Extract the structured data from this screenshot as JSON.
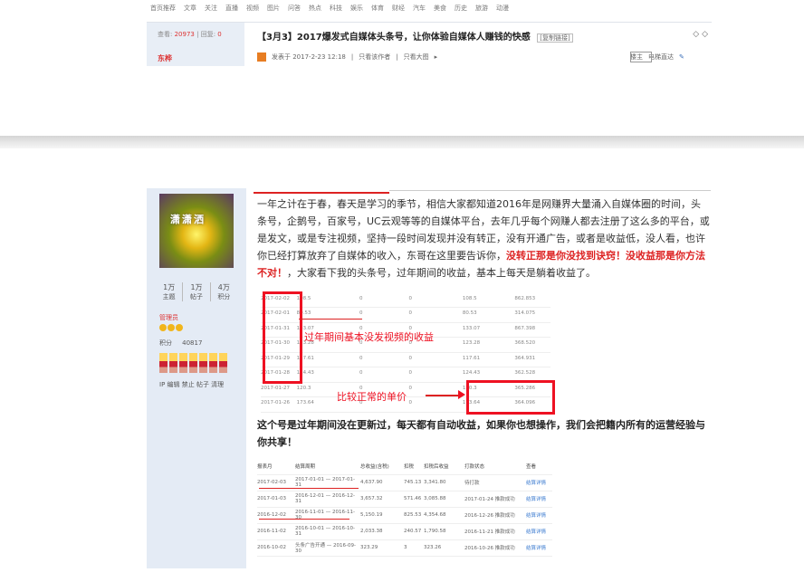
{
  "nav": [
    "首页推荐",
    "文章",
    "关注",
    "直播",
    "视频",
    "图片",
    "问答",
    "热点",
    "科技",
    "娱乐",
    "体育",
    "财经",
    "汽车",
    "美食",
    "历史",
    "旅游",
    "动漫"
  ],
  "post": {
    "views_label": "查看:",
    "views": "20973",
    "replies_label": "回复:",
    "replies": "0",
    "author": "东桦",
    "title": "【3月3】2017爆发式自媒体头条号，让你体验自媒体人赚钱的快感",
    "tag": "[复制链接]",
    "posted": "发表于 2017-2-23 12:18",
    "only_author": "只看该作者",
    "only_large": "只看大图",
    "floor_label": "楼主",
    "goto_label": "电梯直达"
  },
  "user": {
    "avatar_text": "潇潇洒",
    "topics": "1万",
    "topics_label": "主题",
    "posts": "1万",
    "posts_label": "帖子",
    "score": "4万",
    "score_label": "积分",
    "group": "管理员",
    "points_label": "积分",
    "points": "40817",
    "links": "IP 编辑 禁止 帖子 清理"
  },
  "body": {
    "paragraph": "一年之计在于春，春天是学习的季节，相信大家都知道2016年是网赚界大量涌入自媒体圈的时间，头条号，企鹅号，百家号，UC云观等等的自媒体平台，去年几乎每个网赚人都去注册了这么多的平台，或是发文，或是专注视频，坚持一段时间发现并没有转正，没有开通广告，或者是收益低，没人看，也许你已经打算放弃了自媒体的收入，东哥在这里要告诉你，",
    "red_text": "没转正那是你没找到诀窍！没收益那是你方法不对！",
    "tail": "，大家看下我的头条号，过年期间的收益，基本上每天是躺着收益了。",
    "annotation_1": "过年期间基本没发视频的收益",
    "annotation_2": "比较正常的单价",
    "summary": "这个号是过年期间没在更新过，每天都有自动收益，如果你也想操作，我们会把籍内所有的运营经验与你共享！"
  },
  "table1": [
    [
      "2017-02-02",
      "108.5",
      "0",
      "0",
      "108.5",
      "862.853"
    ],
    [
      "2017-02-01",
      "80.53",
      "0",
      "0",
      "80.53",
      "314.075"
    ],
    [
      "2017-01-31",
      "133.07",
      "0",
      "0",
      "133.07",
      "867.398"
    ],
    [
      "2017-01-30",
      "123.28",
      "0",
      "0",
      "123.28",
      "368.520"
    ],
    [
      "2017-01-29",
      "117.61",
      "0",
      "0",
      "117.61",
      "364.931"
    ],
    [
      "2017-01-28",
      "124.43",
      "0",
      "0",
      "124.43",
      "362.528"
    ],
    [
      "2017-01-27",
      "120.3",
      "0",
      "0",
      "120.3",
      "365.286"
    ],
    [
      "2017-01-26",
      "173.64",
      "0",
      "0",
      "173.64",
      "364.096"
    ]
  ],
  "table2": {
    "headers": [
      "报表月",
      "结算周期",
      "总收益(含税)",
      "扣税",
      "扣税后收益",
      "打款状态",
      "查看"
    ],
    "rows": [
      [
        "2017-02-03",
        "2017-01-01 — 2017-01-31",
        "4,637.90",
        "745.13",
        "3,341.80",
        "待打款",
        "结算详情"
      ],
      [
        "2017-01-03",
        "2016-12-01 — 2016-12-31",
        "3,657.32",
        "571.46",
        "3,085.88",
        "2017-01-24 推款成功",
        "结算详情"
      ],
      [
        "2016-12-02",
        "2016-11-01 — 2016-11-30",
        "5,150.19",
        "825.53",
        "4,354.68",
        "2016-12-26 推款成功",
        "结算详情"
      ],
      [
        "2016-11-02",
        "2016-10-01 — 2016-10-31",
        "2,033.38",
        "240.57",
        "1,790.58",
        "2016-11-21 推款成功",
        "结算详情"
      ],
      [
        "2016-10-02",
        "头条广告开通 — 2016-09-30",
        "323.29",
        "3",
        "323.26",
        "2016-10-26 推款成功",
        "结算详情"
      ]
    ]
  }
}
